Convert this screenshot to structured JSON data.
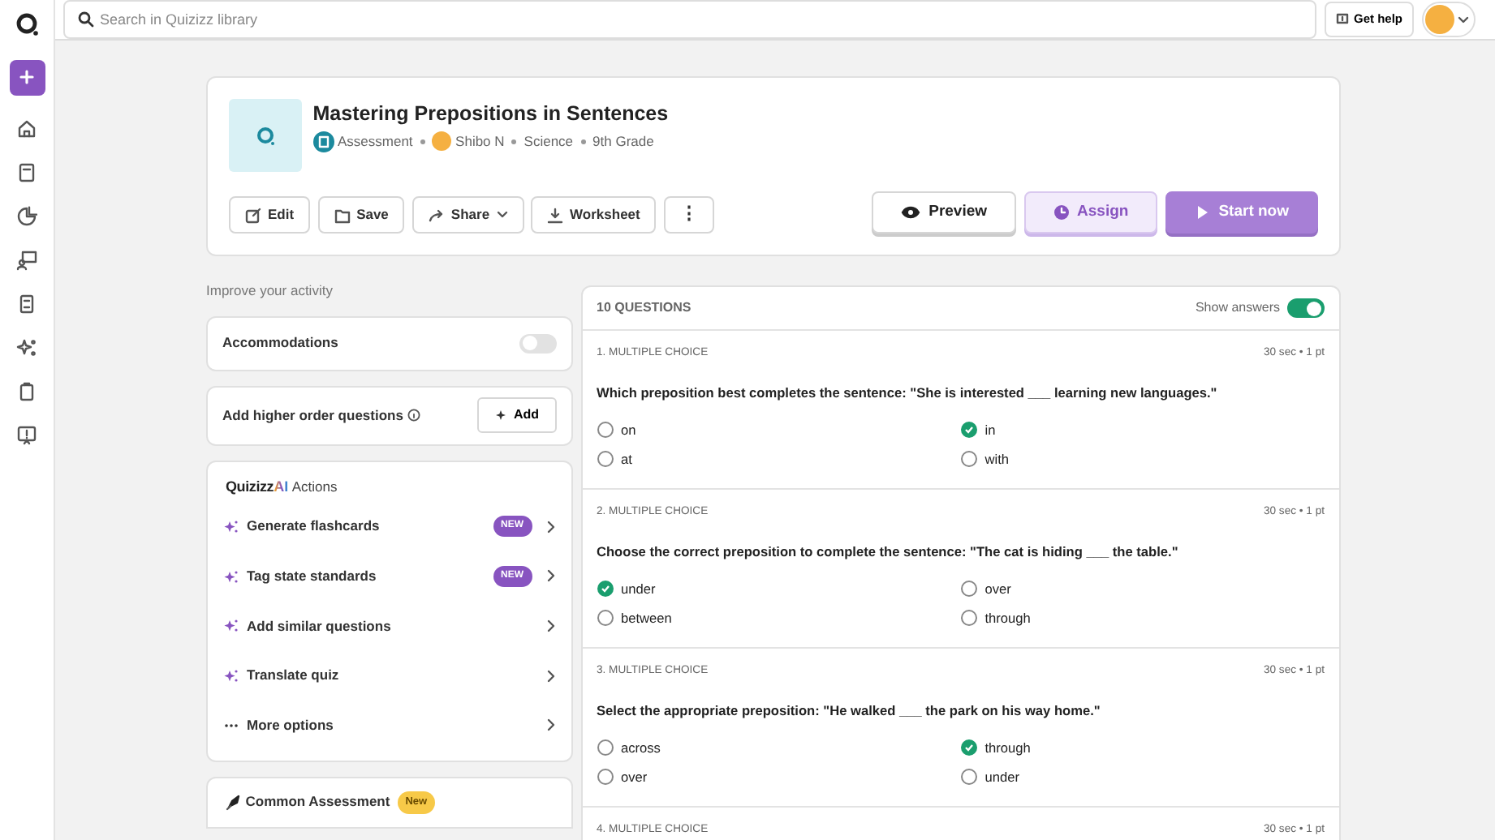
{
  "top_bar": {
    "search": {
      "placeholder": "Search in Quizizz library"
    },
    "help_button": "Get help"
  },
  "activity": {
    "title": "Mastering Prepositions in Sentences",
    "meta": [
      {
        "kind": "type",
        "label": "Assessment"
      },
      {
        "kind": "author",
        "label": "Shibo N"
      },
      {
        "kind": "plain",
        "label": "Science"
      },
      {
        "kind": "plain",
        "label": "9th Grade"
      }
    ],
    "tools": [
      {
        "kind": "edit",
        "label": "Edit"
      },
      {
        "kind": "save",
        "label": "Save"
      },
      {
        "kind": "share",
        "label": "Share"
      },
      {
        "kind": "worksheet",
        "label": "Worksheet"
      },
      {
        "kind": "more",
        "label": "⋮"
      }
    ],
    "actions": [
      {
        "kind": "preview",
        "label": "Preview"
      },
      {
        "kind": "assign",
        "label": "Assign"
      },
      {
        "kind": "start",
        "label": "Start now"
      }
    ]
  },
  "improve": {
    "heading": "Improve your activity",
    "accommodations": {
      "label": "Accommodations",
      "on": false
    },
    "higher_order": {
      "label": "Add higher order questions",
      "button": "Add"
    },
    "ai_actions": {
      "logo_text": "Quizizz",
      "logo_badge": "AI",
      "title": "Actions",
      "items": [
        {
          "kind": "ai",
          "label": "Generate flashcards",
          "badge": "NEW"
        },
        {
          "kind": "ai",
          "label": "Tag state standards",
          "badge": "NEW"
        },
        {
          "kind": "ai",
          "label": "Add similar questions"
        },
        {
          "kind": "ai",
          "label": "Translate quiz"
        },
        {
          "kind": "more",
          "label": "More options"
        }
      ]
    },
    "common_assessment": {
      "label": "Common Assessment",
      "badge": "New"
    }
  },
  "questions": {
    "count_label": "10 QUESTIONS",
    "show_answers": {
      "label": "Show answers",
      "on": true
    },
    "items": [
      {
        "type_label": "1. MULTIPLE CHOICE",
        "meta": "30 sec • 1 pt",
        "text": "Which preposition best completes the sentence: \"She is interested ___ learning new languages.\"",
        "options": [
          {
            "label": "on",
            "correct": false
          },
          {
            "label": "in",
            "correct": true
          },
          {
            "label": "at",
            "correct": false
          },
          {
            "label": "with",
            "correct": false
          }
        ]
      },
      {
        "type_label": "2. MULTIPLE CHOICE",
        "meta": "30 sec • 1 pt",
        "text": "Choose the correct preposition to complete the sentence: \"The cat is hiding ___ the table.\"",
        "options": [
          {
            "label": "under",
            "correct": true
          },
          {
            "label": "over",
            "correct": false
          },
          {
            "label": "between",
            "correct": false
          },
          {
            "label": "through",
            "correct": false
          }
        ]
      },
      {
        "type_label": "3. MULTIPLE CHOICE",
        "meta": "30 sec • 1 pt",
        "text": "Select the appropriate preposition: \"He walked ___ the park on his way home.\"",
        "options": [
          {
            "label": "across",
            "correct": false
          },
          {
            "label": "through",
            "correct": true
          },
          {
            "label": "over",
            "correct": false
          },
          {
            "label": "under",
            "correct": false
          }
        ]
      },
      {
        "type_label": "4. MULTIPLE CHOICE",
        "meta": "30 sec • 1 pt"
      }
    ]
  }
}
